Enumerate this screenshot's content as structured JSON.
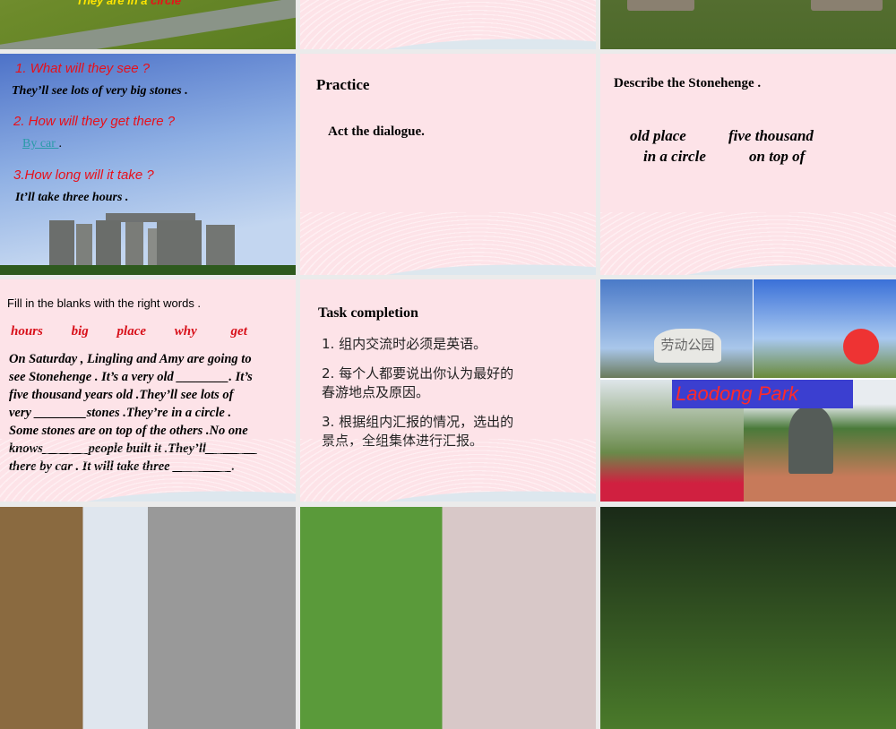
{
  "slide1": {
    "caption_a": "They are in a ",
    "caption_b": "circle"
  },
  "slide4": {
    "q1": "1. What will they see ?",
    "a1": "They’ll see lots of very big stones .",
    "q2": "2. How will they get there ?",
    "a2_link": "By car ",
    "a2_end": ".",
    "q3": "3.How long will it take ?",
    "a3": "It’ll take three hours ."
  },
  "slide5": {
    "title": "Practice",
    "body": "Act the dialogue."
  },
  "slide6": {
    "title": "Describe the Stonehenge .",
    "words_row1": [
      "old place",
      "five thousand"
    ],
    "words_row2": [
      "in a circle",
      "on top of"
    ]
  },
  "slide7": {
    "title": "Fill in the blanks with the right words .",
    "words": [
      "hours",
      "big",
      "place",
      "why",
      "get"
    ],
    "lines": [
      "On Saturday , Lingling and Amy are going to",
      "see Stonehenge . It’s a very old ________. It’s",
      "five thousand years old .They’ll see lots of",
      "very ________stones .They’re in a circle .",
      "Some stones are on top of the others .No one",
      "knows_______people built it .They’ll________",
      "there by car . It will take three _________."
    ]
  },
  "slide8": {
    "title": "Task completion",
    "items": [
      "1. 组内交流时必须是英语。",
      "2. 每个人都要说出你认为最好的",
      "春游地点及原因。",
      "3. 根据组内汇报的情况，选出的",
      "景点，全组集体进行汇报。"
    ]
  },
  "slide9": {
    "banner": "Laodong Park",
    "sign": "劳动公园"
  },
  "colors": {
    "accent_red": "#e8101a",
    "link": "#2a9aa8",
    "banner_bg": "#3b3fd0"
  }
}
